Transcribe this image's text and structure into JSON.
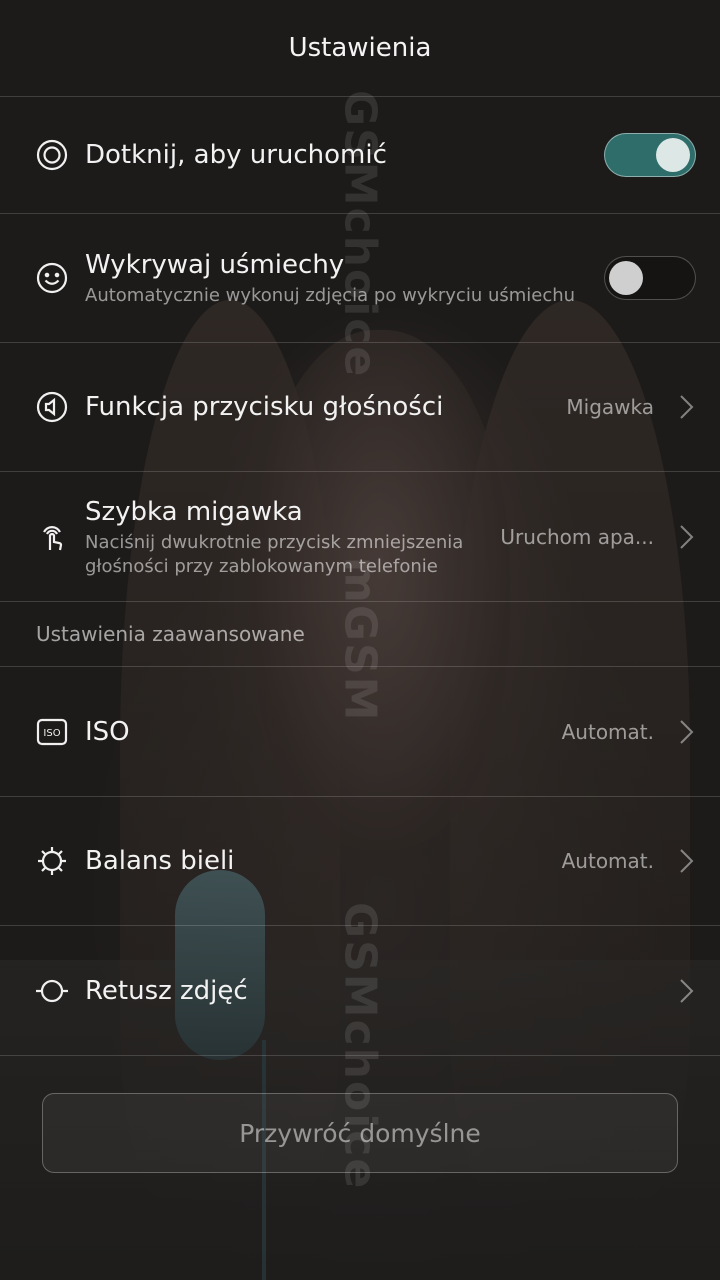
{
  "header": {
    "title": "Ustawienia"
  },
  "watermark": {
    "text": "GSMchoice",
    "text_alt": "mGSM"
  },
  "settings": [
    {
      "icon": "target-circle-icon",
      "label": "Dotknij, aby uruchomić",
      "control": "toggle",
      "toggle_on": true
    },
    {
      "icon": "smiley-icon",
      "label": "Wykrywaj uśmiechy",
      "sub": "Automatycznie wykonuj zdjęcia po wykryciu uśmiechu",
      "control": "toggle",
      "toggle_on": false
    },
    {
      "icon": "volume-key-icon",
      "label": "Funkcja przycisku głośności",
      "value": "Migawka",
      "control": "chevron"
    },
    {
      "icon": "tap-gesture-icon",
      "label": "Szybka migawka",
      "sub": "Naciśnij dwukrotnie przycisk zmniejszenia głośności przy zablokowanym telefonie",
      "value": "Uruchom apa...",
      "control": "chevron"
    }
  ],
  "advanced": {
    "header": "Ustawienia zaawansowane",
    "items": [
      {
        "icon": "iso-icon",
        "icon_text": "ISO",
        "label": "ISO",
        "value": "Automat.",
        "control": "chevron"
      },
      {
        "icon": "sun-icon",
        "label": "Balans bieli",
        "value": "Automat.",
        "control": "chevron"
      },
      {
        "icon": "retouch-icon",
        "label": "Retusz zdjęć",
        "value": "",
        "control": "chevron"
      }
    ]
  },
  "reset": {
    "label": "Przywróć domyślne"
  },
  "colors": {
    "accent": "#2e6d6a",
    "text": "#f2f2f2",
    "secondary": "#8c8c8c"
  }
}
